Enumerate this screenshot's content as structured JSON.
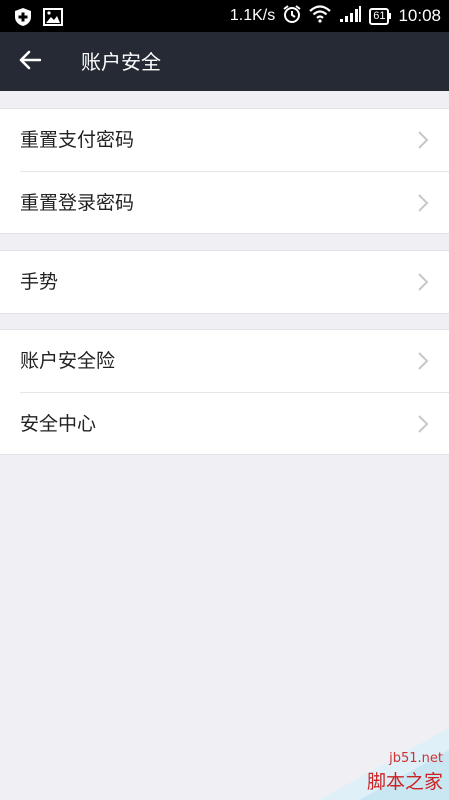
{
  "status_bar": {
    "speed": "1.1K/s",
    "battery": "61",
    "time": "10:08"
  },
  "nav": {
    "title": "账户安全"
  },
  "groups": [
    {
      "items": [
        {
          "label": "重置支付密码"
        },
        {
          "label": "重置登录密码"
        }
      ]
    },
    {
      "items": [
        {
          "label": "手势"
        }
      ]
    },
    {
      "items": [
        {
          "label": "账户安全险"
        },
        {
          "label": "安全中心"
        }
      ]
    }
  ],
  "watermark": {
    "url": "jb51.net",
    "text": "脚本之家"
  },
  "colors": {
    "nav_bg": "#262a34",
    "page_bg": "#efeff4",
    "chevron": "#c7c7cc"
  }
}
